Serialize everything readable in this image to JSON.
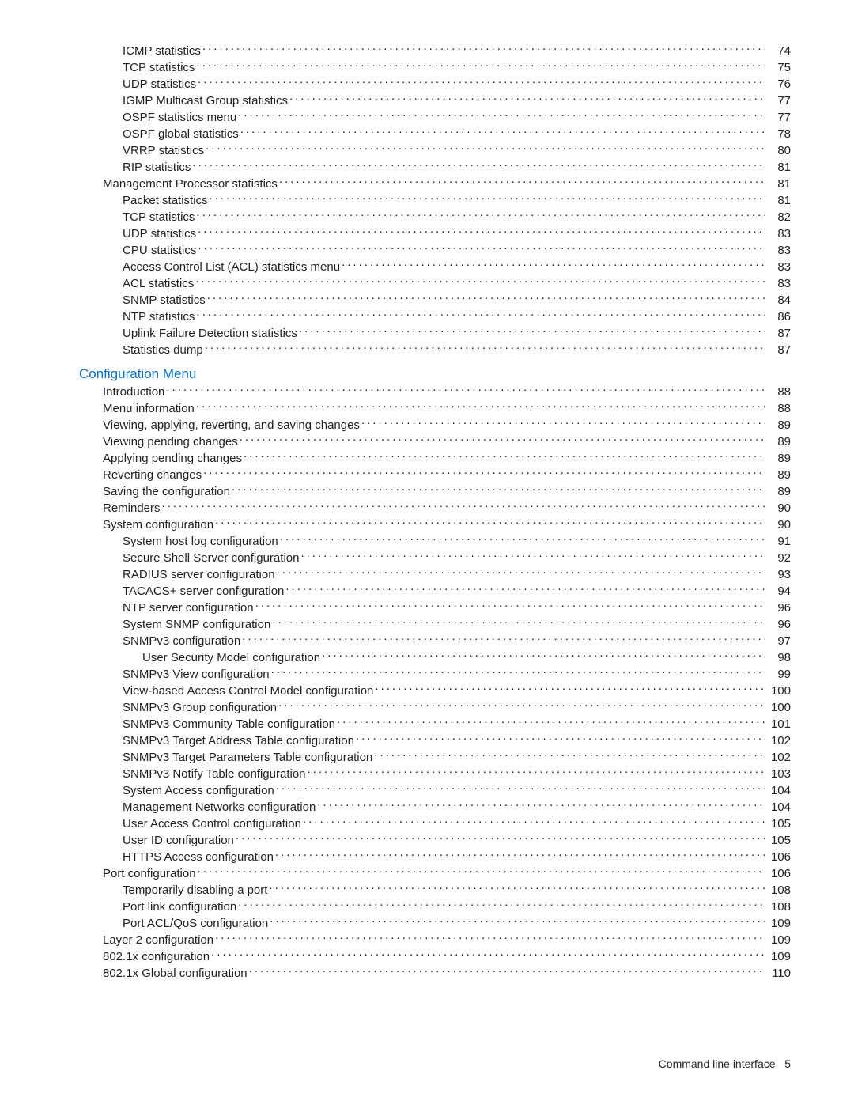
{
  "section1": {
    "items": [
      {
        "label": "ICMP statistics",
        "page": "74",
        "indent": 1
      },
      {
        "label": "TCP statistics",
        "page": "75",
        "indent": 1
      },
      {
        "label": "UDP statistics",
        "page": "76",
        "indent": 1
      },
      {
        "label": "IGMP Multicast Group statistics",
        "page": "77",
        "indent": 1
      },
      {
        "label": "OSPF statistics menu",
        "page": "77",
        "indent": 1
      },
      {
        "label": "OSPF global statistics",
        "page": "78",
        "indent": 1
      },
      {
        "label": "VRRP statistics",
        "page": "80",
        "indent": 1
      },
      {
        "label": "RIP statistics",
        "page": "81",
        "indent": 1
      },
      {
        "label": "Management Processor statistics",
        "page": "81",
        "indent": 0
      },
      {
        "label": "Packet statistics",
        "page": "81",
        "indent": 1
      },
      {
        "label": "TCP statistics",
        "page": "82",
        "indent": 1
      },
      {
        "label": "UDP statistics",
        "page": "83",
        "indent": 1
      },
      {
        "label": "CPU statistics",
        "page": "83",
        "indent": 1
      },
      {
        "label": "Access Control List (ACL) statistics menu",
        "page": "83",
        "indent": 1
      },
      {
        "label": "ACL statistics",
        "page": "83",
        "indent": 1
      },
      {
        "label": "SNMP statistics",
        "page": "84",
        "indent": 1
      },
      {
        "label": "NTP statistics",
        "page": "86",
        "indent": 1
      },
      {
        "label": "Uplink Failure Detection statistics",
        "page": "87",
        "indent": 1
      },
      {
        "label": "Statistics dump",
        "page": "87",
        "indent": 1
      }
    ]
  },
  "section2": {
    "heading": "Configuration Menu",
    "items": [
      {
        "label": "Introduction",
        "page": "88",
        "indent": 0
      },
      {
        "label": "Menu information",
        "page": "88",
        "indent": 0
      },
      {
        "label": "Viewing, applying, reverting, and saving changes",
        "page": "89",
        "indent": 0
      },
      {
        "label": "Viewing pending changes",
        "page": "89",
        "indent": 0
      },
      {
        "label": "Applying pending changes",
        "page": "89",
        "indent": 0
      },
      {
        "label": "Reverting changes",
        "page": "89",
        "indent": 0
      },
      {
        "label": "Saving the configuration",
        "page": "89",
        "indent": 0
      },
      {
        "label": "Reminders",
        "page": "90",
        "indent": 0
      },
      {
        "label": "System configuration",
        "page": "90",
        "indent": 0
      },
      {
        "label": "System host log configuration",
        "page": "91",
        "indent": 1
      },
      {
        "label": "Secure Shell Server configuration",
        "page": "92",
        "indent": 1
      },
      {
        "label": "RADIUS server configuration",
        "page": "93",
        "indent": 1
      },
      {
        "label": "TACACS+ server configuration",
        "page": "94",
        "indent": 1
      },
      {
        "label": "NTP server configuration",
        "page": "96",
        "indent": 1
      },
      {
        "label": "System SNMP configuration",
        "page": "96",
        "indent": 1
      },
      {
        "label": "SNMPv3 configuration",
        "page": "97",
        "indent": 1
      },
      {
        "label": "User Security Model configuration",
        "page": "98",
        "indent": 2
      },
      {
        "label": "SNMPv3 View configuration",
        "page": "99",
        "indent": 1
      },
      {
        "label": "View-based Access Control Model configuration",
        "page": "100",
        "indent": 1
      },
      {
        "label": "SNMPv3 Group configuration",
        "page": "100",
        "indent": 1
      },
      {
        "label": "SNMPv3 Community Table configuration",
        "page": "101",
        "indent": 1
      },
      {
        "label": "SNMPv3 Target Address Table configuration",
        "page": "102",
        "indent": 1
      },
      {
        "label": "SNMPv3 Target Parameters Table configuration",
        "page": "102",
        "indent": 1
      },
      {
        "label": "SNMPv3 Notify Table configuration",
        "page": "103",
        "indent": 1
      },
      {
        "label": "System Access configuration",
        "page": "104",
        "indent": 1
      },
      {
        "label": "Management Networks configuration",
        "page": "104",
        "indent": 1
      },
      {
        "label": "User Access Control configuration",
        "page": "105",
        "indent": 1
      },
      {
        "label": "User ID configuration",
        "page": "105",
        "indent": 1
      },
      {
        "label": "HTTPS Access configuration",
        "page": "106",
        "indent": 1
      },
      {
        "label": "Port configuration",
        "page": "106",
        "indent": 0
      },
      {
        "label": "Temporarily disabling a port",
        "page": "108",
        "indent": 1
      },
      {
        "label": "Port link configuration",
        "page": "108",
        "indent": 1
      },
      {
        "label": "Port ACL/QoS configuration",
        "page": "109",
        "indent": 1
      },
      {
        "label": "Layer 2 configuration",
        "page": "109",
        "indent": 0
      },
      {
        "label": "802.1x configuration",
        "page": "109",
        "indent": 0
      },
      {
        "label": "802.1x Global configuration",
        "page": "110",
        "indent": 0
      }
    ]
  },
  "footer": {
    "text": "Command line interface",
    "page": "5"
  }
}
